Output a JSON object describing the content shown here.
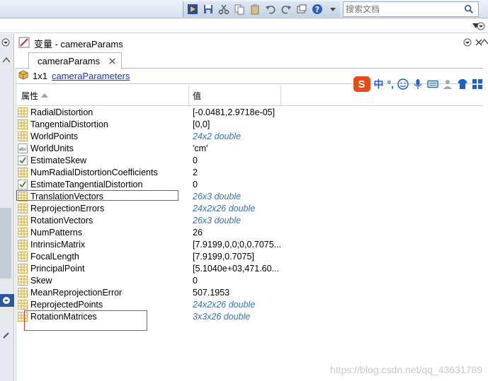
{
  "search": {
    "placeholder": "搜索文档"
  },
  "panel": {
    "title": "变量 - cameraParams",
    "tab_label": "cameraParams",
    "size_label": "1x1",
    "class_link": "cameraParameters"
  },
  "ime": {
    "lang": "中",
    "punct": "°,"
  },
  "table": {
    "headers": {
      "property": "属性",
      "value": "值"
    },
    "rows": [
      {
        "icon": "matrix-icon",
        "name": "RadialDistortion",
        "value": "[-0.0481,2.9718e-05]",
        "italic": false
      },
      {
        "icon": "matrix-icon",
        "name": "TangentialDistortion",
        "value": "[0,0]",
        "italic": false
      },
      {
        "icon": "matrix-icon",
        "name": "WorldPoints",
        "value": "24x2 double",
        "italic": true
      },
      {
        "icon": "char-icon",
        "name": "WorldUnits",
        "value": "'cm'",
        "italic": false
      },
      {
        "icon": "logical-icon",
        "name": "EstimateSkew",
        "value": "0",
        "italic": false
      },
      {
        "icon": "matrix-icon",
        "name": "NumRadialDistortionCoefficients",
        "value": "2",
        "italic": false
      },
      {
        "icon": "logical-icon",
        "name": "EstimateTangentialDistortion",
        "value": "0",
        "italic": false
      },
      {
        "icon": "matrix-icon",
        "name": "TranslationVectors",
        "value": "26x3 double",
        "italic": true
      },
      {
        "icon": "matrix-icon",
        "name": "ReprojectionErrors",
        "value": "24x2x26 double",
        "italic": true
      },
      {
        "icon": "matrix-icon",
        "name": "RotationVectors",
        "value": "26x3 double",
        "italic": true
      },
      {
        "icon": "matrix-icon",
        "name": "NumPatterns",
        "value": "26",
        "italic": false
      },
      {
        "icon": "matrix-icon",
        "name": "IntrinsicMatrix",
        "value": "[7.9199,0,0;0,0.7075...",
        "italic": false
      },
      {
        "icon": "matrix-icon",
        "name": "FocalLength",
        "value": "[7.9199,0.7075]",
        "italic": false
      },
      {
        "icon": "matrix-icon",
        "name": "PrincipalPoint",
        "value": "[5.1040e+03,471.60...",
        "italic": false
      },
      {
        "icon": "matrix-icon",
        "name": "Skew",
        "value": "0",
        "italic": false
      },
      {
        "icon": "matrix-icon",
        "name": "MeanReprojectionError",
        "value": "507.1953",
        "italic": false
      },
      {
        "icon": "matrix-icon",
        "name": "ReprojectedPoints",
        "value": "24x2x26 double",
        "italic": true
      },
      {
        "icon": "matrix-icon",
        "name": "RotationMatrices",
        "value": "3x3x26 double",
        "italic": true
      }
    ]
  },
  "watermark": "https://blog.csdn.net/qq_43631789",
  "colors": {
    "highlight_box": "#e03b3b",
    "link": "#1b36c8",
    "italic_value": "#3b6fb0"
  }
}
